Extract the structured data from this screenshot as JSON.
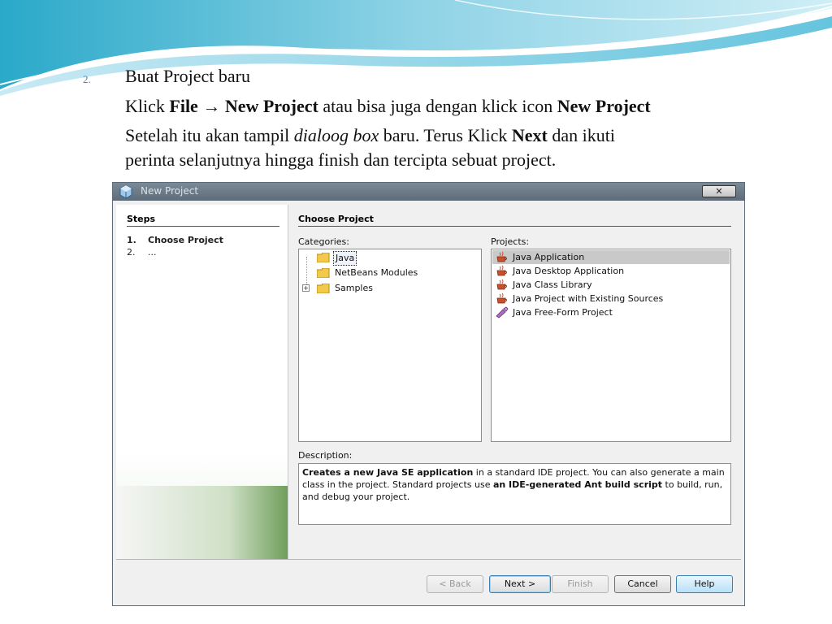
{
  "slide": {
    "bullet_number": "2.",
    "line1": "Buat Project baru",
    "line2": {
      "klick": "Klick ",
      "file": "File",
      "arrow": "→",
      "new_project": "New Project",
      "middle": " atau bisa juga dengan klick icon ",
      "new_project_icon": "New Project"
    },
    "line3": {
      "setelah": "Setelah  itu akan tampil ",
      "dialoog_box": "dialoog box",
      "baru": " baru. Terus  Klick ",
      "next": "Next",
      "dan_ikuti": " dan ikuti"
    },
    "line4": "perinta selanjutnya hingga finish dan tercipta sebuat project."
  },
  "dialog": {
    "title": "New Project",
    "close_label": "✕",
    "steps": {
      "title": "Steps",
      "items": [
        {
          "num": "1.",
          "label": "Choose Project"
        },
        {
          "num": "2.",
          "label": "..."
        }
      ]
    },
    "choose_project_title": "Choose Project",
    "categories_label": "Categories:",
    "projects_label": "Projects:",
    "categories": [
      {
        "label": "Java",
        "selected": true,
        "expandable": false
      },
      {
        "label": "NetBeans Modules",
        "selected": false,
        "expandable": false
      },
      {
        "label": "Samples",
        "selected": false,
        "expandable": true,
        "expander": "+"
      }
    ],
    "projects": [
      {
        "label": "Java Application",
        "icon": "coffee-cup-icon",
        "selected": true
      },
      {
        "label": "Java Desktop Application",
        "icon": "coffee-cup-icon",
        "selected": false
      },
      {
        "label": "Java Class Library",
        "icon": "coffee-cup-icon",
        "selected": false
      },
      {
        "label": "Java Project with Existing Sources",
        "icon": "coffee-cup-icon",
        "selected": false
      },
      {
        "label": "Java Free-Form Project",
        "icon": "freeform-project-icon",
        "selected": false
      }
    ],
    "description_label": "Description:",
    "description": {
      "b1": "Creates a new Java SE application",
      "t1": " in a standard IDE project. You can also generate a main class in the project. Standard projects use ",
      "b2": "an IDE-generated Ant build script",
      "t2": " to build, run, and debug your project."
    },
    "buttons": {
      "back": "< Back",
      "next": "Next >",
      "finish": "Finish",
      "cancel": "Cancel",
      "help": "Help"
    }
  },
  "colors": {
    "accent_blue": "#4a7fb0",
    "titlebar": "#6b7986",
    "selection_gray": "#c9c9c9",
    "folder_yellow": "#f2c94c"
  }
}
